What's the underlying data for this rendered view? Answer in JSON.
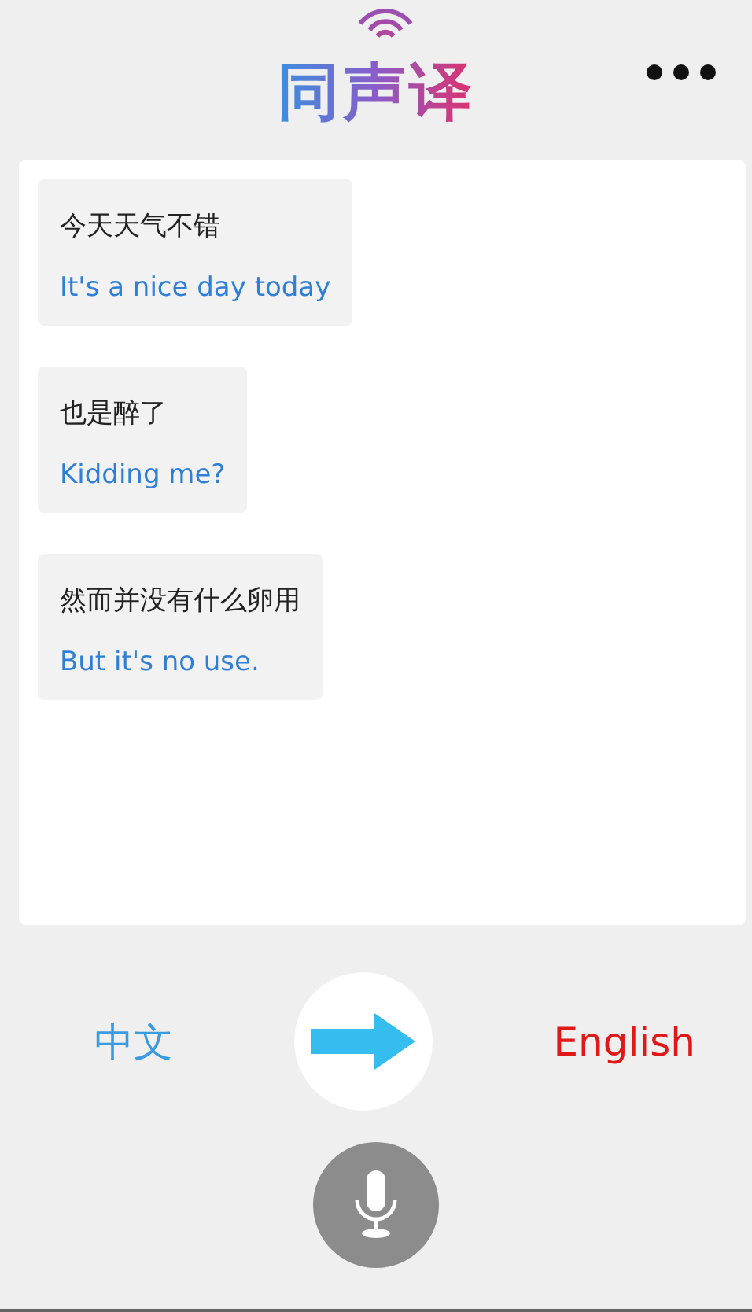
{
  "header": {
    "title": "同声译"
  },
  "messages": [
    {
      "source": "今天天气不错",
      "translation": "It's a nice day today"
    },
    {
      "source": "也是醉了",
      "translation": "Kidding me?"
    },
    {
      "source": "然而并没有什么卵用",
      "translation": "But it's no use."
    }
  ],
  "languages": {
    "from": "中文",
    "to": "English"
  }
}
